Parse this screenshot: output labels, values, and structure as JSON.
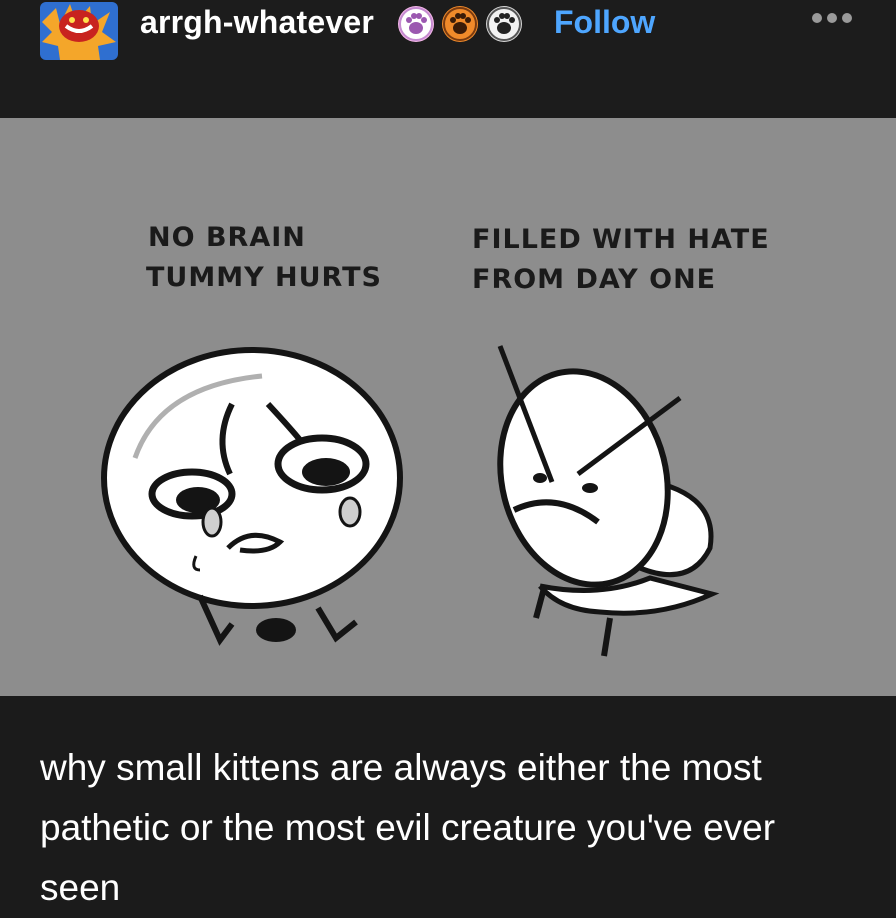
{
  "post": {
    "username": "arrgh-whatever",
    "follow_label": "Follow",
    "avatar_icon": "red-devil-avatar-icon",
    "badges": [
      {
        "icon": "paw-badge-icon",
        "color": "#f4b7e8"
      },
      {
        "icon": "paw-badge-icon",
        "color": "#f08a2a"
      },
      {
        "icon": "paw-badge-icon",
        "color": "#d6d6d6"
      }
    ],
    "more_icon": "more-options-icon",
    "accent_color": "#4ea6ff"
  },
  "comic": {
    "left_caption_line1": "NO BRAIN",
    "left_caption_line2": "TUMMY HURTS",
    "right_caption_line1": "FILLED WITH HATE",
    "right_caption_line2": "FROM DAY ONE"
  },
  "caption": {
    "text": "why small kittens are always either the most pathetic or the most evil creature you've ever seen"
  }
}
